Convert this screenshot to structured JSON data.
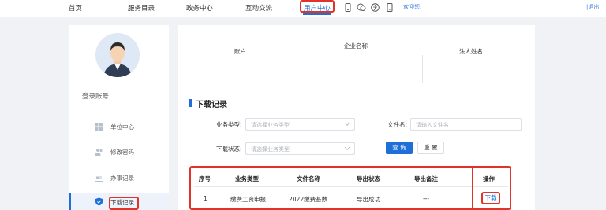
{
  "topnav": {
    "items": [
      "首页",
      "服务目录",
      "政务中心",
      "互动交流",
      "用户中心"
    ],
    "welcome": "欢迎您:",
    "logout": "|退出",
    "icons": [
      "phone-icon",
      "chat-icon",
      "accessibility-icon",
      "mobile-icon"
    ]
  },
  "sidebar": {
    "account_label": "登录账号:",
    "items": [
      {
        "label": "单位中心",
        "icon": "grid-icon"
      },
      {
        "label": "修改密码",
        "icon": "user-group-icon"
      },
      {
        "label": "办事记录",
        "icon": "id-card-icon"
      },
      {
        "label": "下载记录",
        "icon": "shield-icon"
      }
    ]
  },
  "profile": {
    "user_label": "账户",
    "company_label": "企业名称",
    "legal_label": "法人姓名"
  },
  "section": {
    "title": "下载记录"
  },
  "filters": {
    "business_type_label": "业务类型:",
    "business_type_placeholder": "请选择业务类型",
    "file_name_label": "文件名:",
    "file_name_placeholder": "请输入文件名",
    "status_label": "下载状态:",
    "status_placeholder": "请选择业务类型",
    "query_button": "查 询",
    "reset_button": "重 置"
  },
  "table": {
    "headers": [
      "序号",
      "业务类型",
      "文件名称",
      "导出状态",
      "导出备注",
      "操作"
    ],
    "rows": [
      [
        "1",
        "缴费工资申报",
        "2022缴费基数...",
        "导出成功",
        "---",
        "下载"
      ]
    ]
  },
  "colors": {
    "accent": "#1e6fd9",
    "highlight": "#e0332a"
  }
}
